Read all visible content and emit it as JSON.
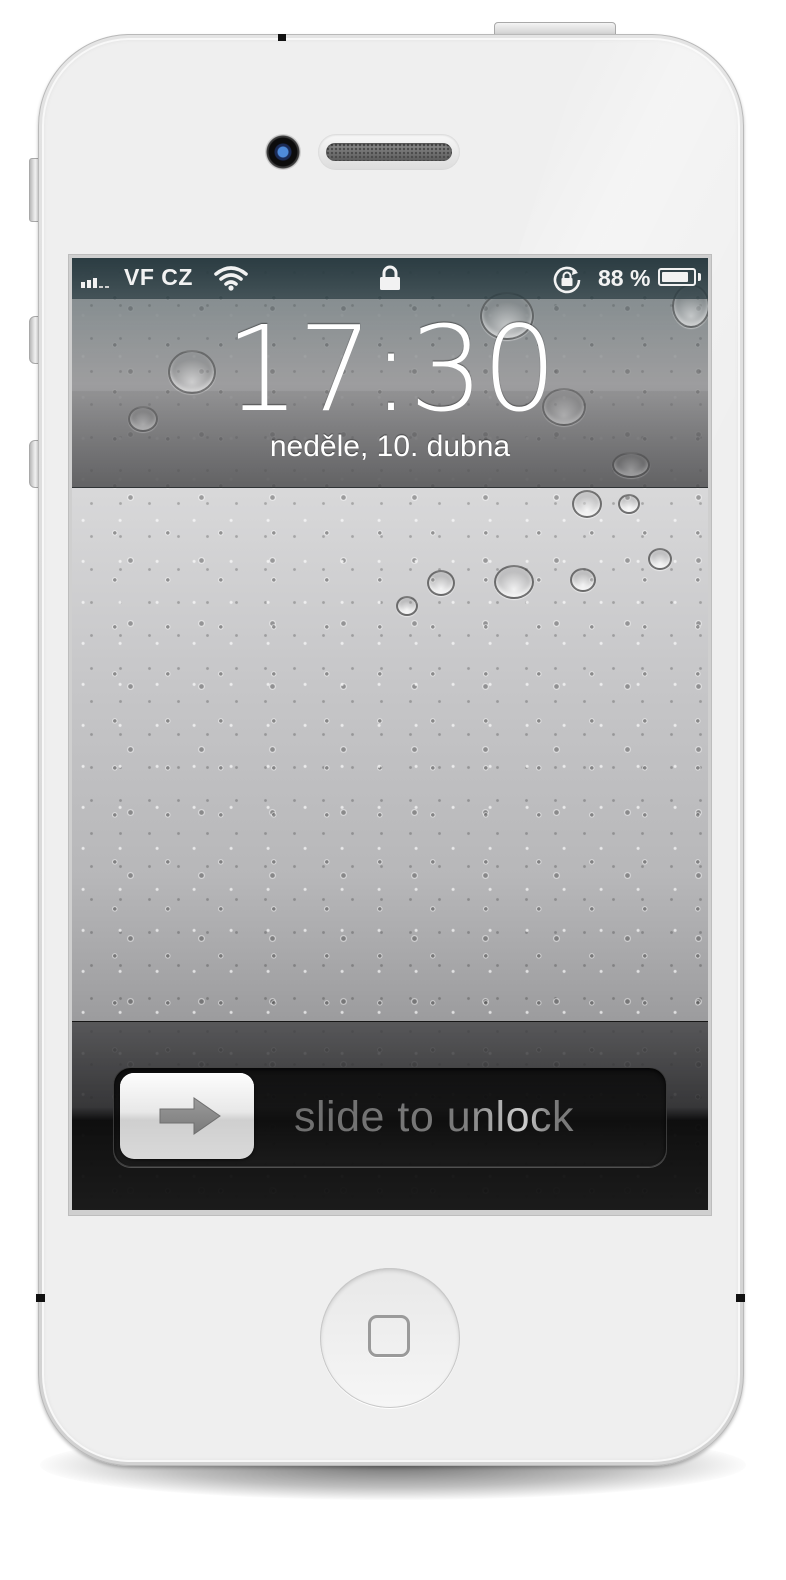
{
  "device": {
    "model": "iPhone (white)"
  },
  "status_bar": {
    "carrier": "VF CZ",
    "battery_percent": "88 %",
    "battery_level": 0.88,
    "icons": [
      "signal-icon",
      "wifi-icon",
      "lock-icon",
      "rotation-lock-icon",
      "battery-icon"
    ]
  },
  "lock_screen": {
    "time": "17:30",
    "date": "neděle, 10. dubna"
  },
  "unlock_slider": {
    "label": "slide to unlock",
    "knob_icon": "arrow-right-icon"
  },
  "colors": {
    "status_text": "#f2f2f2",
    "clock_text": "#ffffff",
    "slider_text": "#7c7c7c",
    "body": "#efefef"
  }
}
